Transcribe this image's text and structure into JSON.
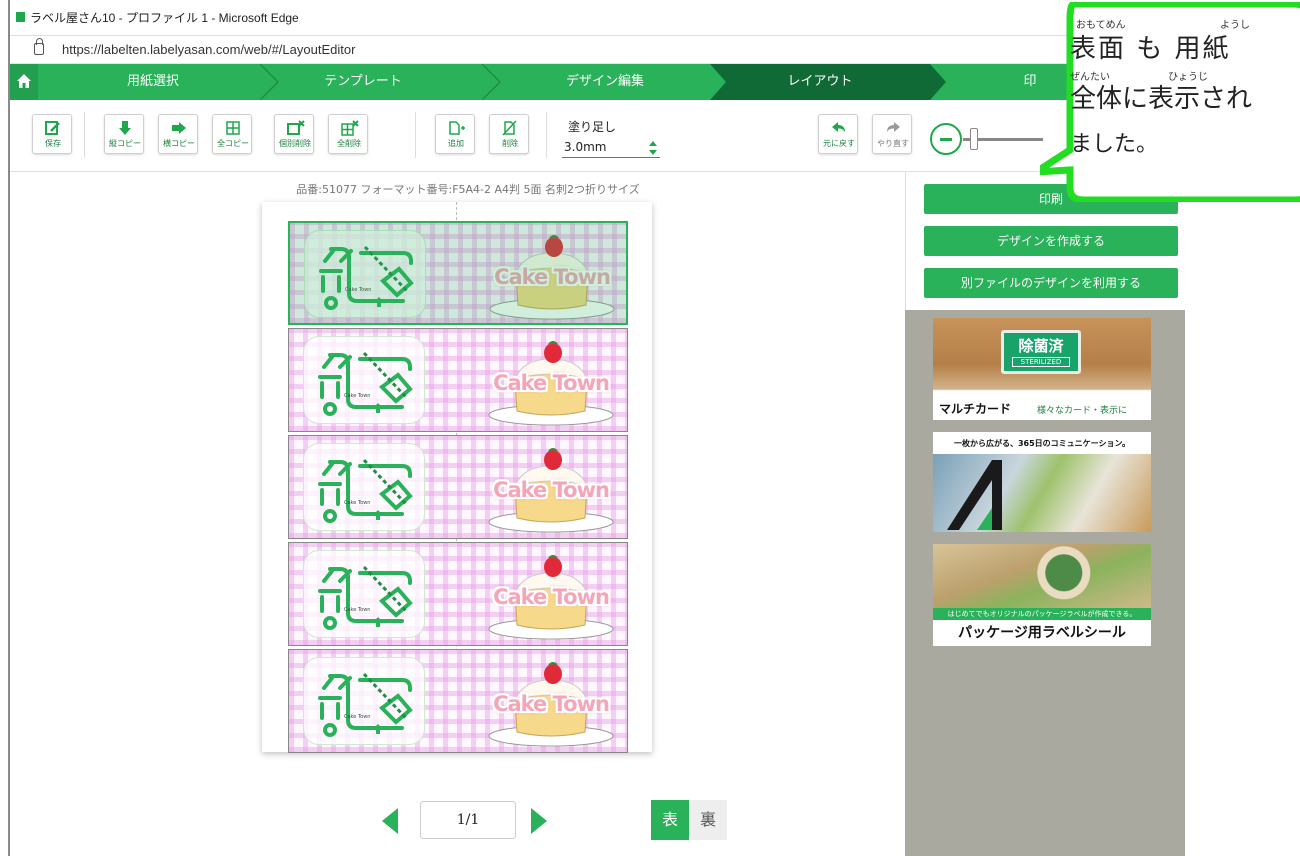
{
  "window": {
    "title": "ラベル屋さん10 - プロファイル 1 - Microsoft Edge",
    "url": "https://labelten.labelyasan.com/web/#/LayoutEditor"
  },
  "steps": [
    {
      "label": "用紙選択"
    },
    {
      "label": "テンプレート"
    },
    {
      "label": "デザイン編集"
    },
    {
      "label": "レイアウト"
    },
    {
      "label": "印"
    }
  ],
  "toolbar": {
    "save": "保存",
    "vertical_copy": "縦コピー",
    "horizontal_copy": "横コピー",
    "all_copy": "全コピー",
    "individual_delete": "個別削除",
    "all_delete": "全削除",
    "add": "追加",
    "delete": "削除",
    "bleed_label": "塗り足し",
    "bleed_value": "3.0mm",
    "undo": "元に戻す",
    "redo": "やり直す"
  },
  "canvas": {
    "meta": "品番:51077 フォーマット番号:F5A4-2 A4判 5面 名刺2つ折りサイズ",
    "label_text": "Cake Town",
    "logo_tiny_text": "Cake Town",
    "label_count": 5
  },
  "pager": {
    "page": "1/1",
    "front": "表",
    "back": "裏"
  },
  "right_panel": {
    "print_button": "印刷",
    "create_design_button": "デザインを作成する",
    "use_other_file_button": "別ファイルのデザインを利用する"
  },
  "ads": {
    "ad1_sign_jp": "除菌済",
    "ad1_sign_en": "STERILIZED",
    "ad1_title": "マルチカード",
    "ad1_sub": "様々なカード・表示に",
    "ad2_title": "一枚から広がる、365日のコミュニケーション。",
    "ad3_band": "はじめてでもオリジナルのパッケージラベルが作成できる。",
    "ad3_title": "パッケージ用ラベルシール"
  },
  "callout": {
    "line1": "表面 も 用紙",
    "line2": "全体に表示され",
    "line3": "ました。",
    "ruby1": "おもてめん",
    "ruby2": "ようし",
    "ruby3": "ぜんたい",
    "ruby4": "ひょうじ"
  },
  "colors": {
    "accent": "#2ab25a",
    "active_step": "#0f6a35",
    "callout_border": "#22dd22"
  }
}
